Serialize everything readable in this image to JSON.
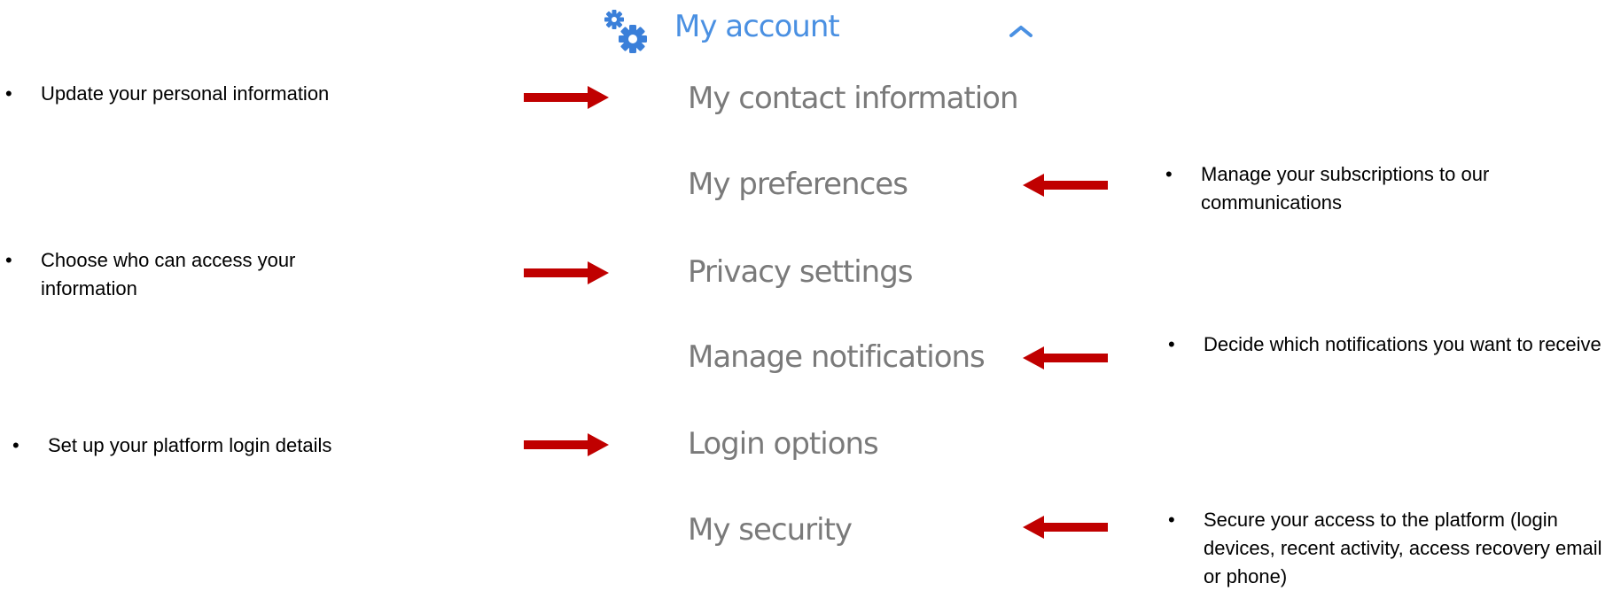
{
  "header": {
    "title": "My account",
    "icon": "gears-icon",
    "toggle_icon": "chevron-up-icon",
    "accent_color": "#4a90e2"
  },
  "menu": {
    "items": [
      {
        "label": "My contact information"
      },
      {
        "label": "My preferences"
      },
      {
        "label": "Privacy settings"
      },
      {
        "label": "Manage notifications"
      },
      {
        "label": "Login options"
      },
      {
        "label": "My security"
      }
    ]
  },
  "annotations": {
    "bullet": "•",
    "arrow_color": "#c00000",
    "left": [
      {
        "text": "Update your personal information",
        "for": "My contact information"
      },
      {
        "text": "Choose who can access your information",
        "for": "Privacy settings"
      },
      {
        "text": "Set up your platform login details",
        "for": "Login options"
      }
    ],
    "right": [
      {
        "text": "Manage your subscriptions to our communications",
        "for": "My preferences"
      },
      {
        "text": "Decide which notifications you want to receive",
        "for": "Manage notifications"
      },
      {
        "text": "Secure your access to the platform (login devices, recent activity, access recovery email or phone)",
        "for": "My security"
      }
    ]
  }
}
